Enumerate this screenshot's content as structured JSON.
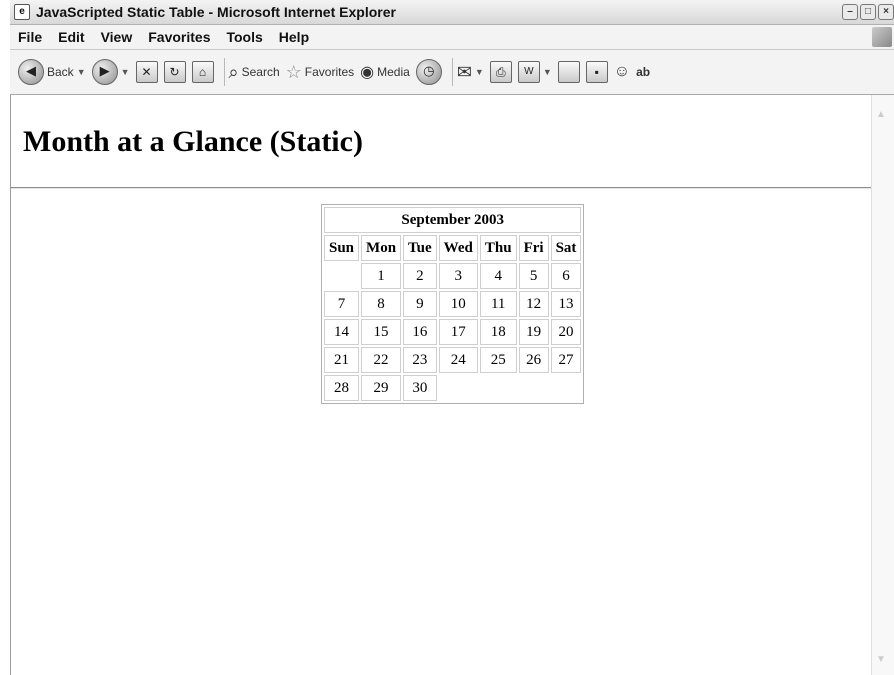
{
  "window": {
    "title": "JavaScripted Static Table - Microsoft Internet Explorer"
  },
  "menu": [
    "File",
    "Edit",
    "View",
    "Favorites",
    "Tools",
    "Help"
  ],
  "toolbar": {
    "back_label": "Back",
    "search_label": "Search",
    "favorites_label": "Favorites",
    "media_label": "Media"
  },
  "page": {
    "heading": "Month at a Glance (Static)"
  },
  "calendar": {
    "caption": "September 2003",
    "weekdays": [
      "Sun",
      "Mon",
      "Tue",
      "Wed",
      "Thu",
      "Fri",
      "Sat"
    ],
    "weeks": [
      [
        "",
        "1",
        "2",
        "3",
        "4",
        "5",
        "6"
      ],
      [
        "7",
        "8",
        "9",
        "10",
        "11",
        "12",
        "13"
      ],
      [
        "14",
        "15",
        "16",
        "17",
        "18",
        "19",
        "20"
      ],
      [
        "21",
        "22",
        "23",
        "24",
        "25",
        "26",
        "27"
      ],
      [
        "28",
        "29",
        "30",
        "",
        "",
        "",
        ""
      ]
    ]
  }
}
